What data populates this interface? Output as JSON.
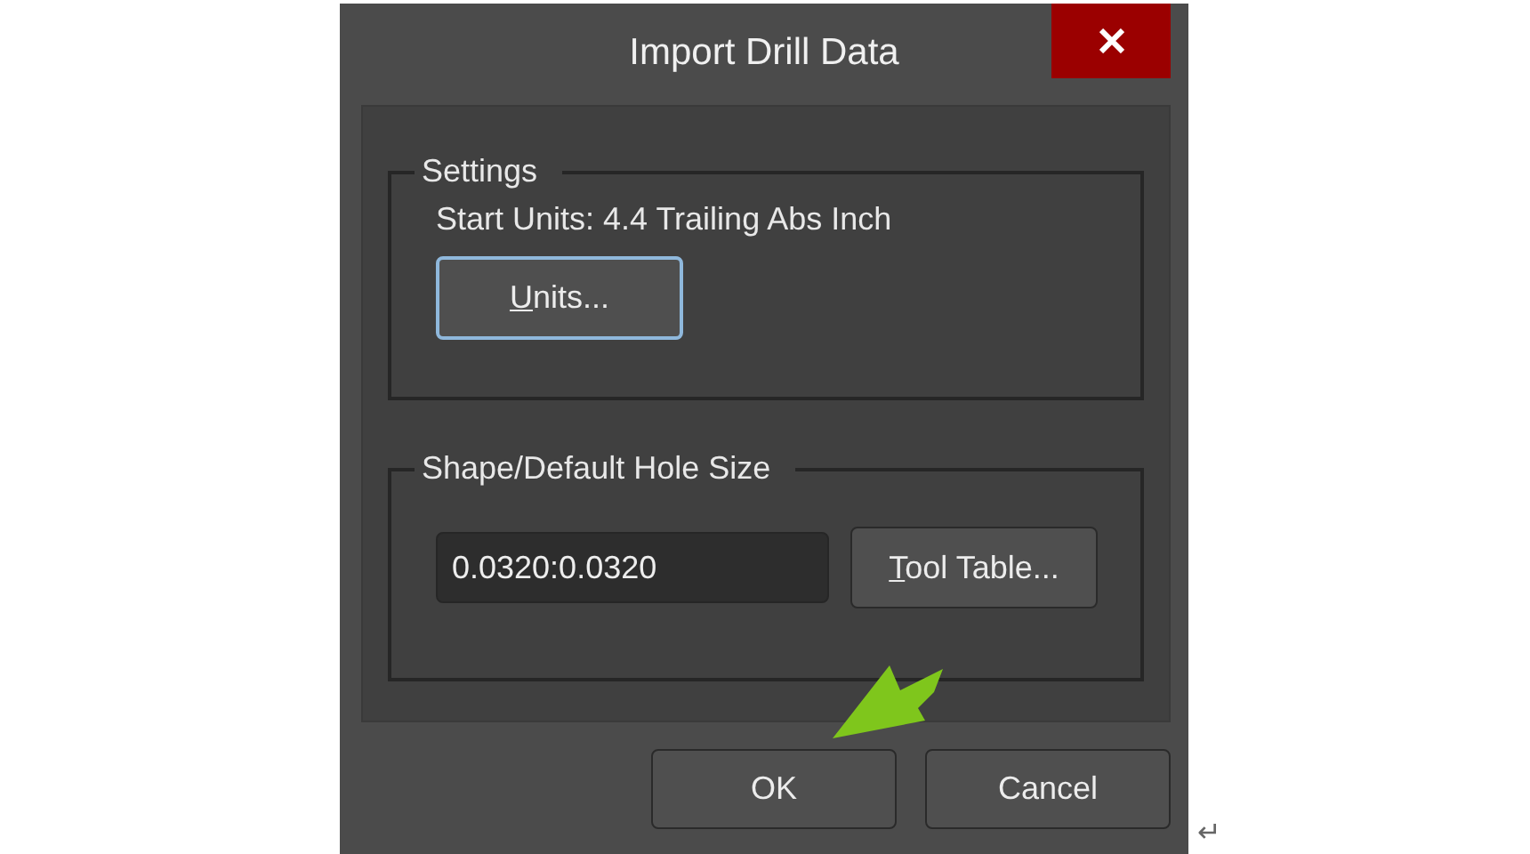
{
  "window": {
    "title": "Import Drill Data"
  },
  "groups": [
    {
      "kind": "settings",
      "legend": "Settings",
      "text": "Start Units: 4.4 Trailing Abs Inch",
      "button": {
        "accel": "U",
        "rest": "nits...",
        "focused": true
      }
    },
    {
      "kind": "hole",
      "legend": "Shape/Default Hole Size",
      "field": {
        "value": "0.0320:0.0320"
      },
      "button": {
        "accel": "T",
        "rest": "ool Table...",
        "focused": false
      }
    }
  ],
  "buttons": [
    {
      "label": "OK"
    },
    {
      "label": "Cancel"
    }
  ],
  "paragraph_mark": "↵"
}
